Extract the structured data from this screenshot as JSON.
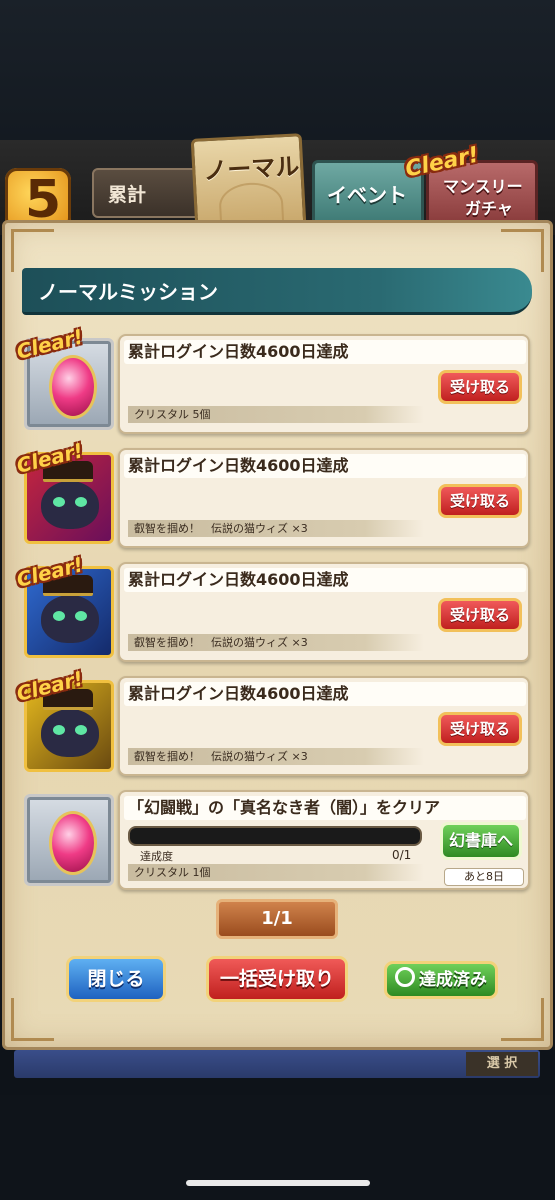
{
  "hud": {
    "number": "5",
    "total_label": "累計"
  },
  "tabs": {
    "normal": "ノーマル",
    "event": "イベント",
    "monthly_line1": "マンスリー",
    "monthly_line2": "ガチャ",
    "monthly_badge": "Clear!"
  },
  "header": {
    "title": "ノーマルミッション"
  },
  "missions": [
    {
      "clear": "Clear!",
      "title": "累計ログイン日数4600日達成",
      "reward": "クリスタル 5個",
      "button": "受け取る",
      "icon": "crystal-icon"
    },
    {
      "clear": "Clear!",
      "title": "累計ログイン日数4600日達成",
      "reward": "叡智を掴め！　伝説の猫ウィズ ×3",
      "button": "受け取る",
      "icon": "wiz-cat-red-icon"
    },
    {
      "clear": "Clear!",
      "title": "累計ログイン日数4600日達成",
      "reward": "叡智を掴め！　伝説の猫ウィズ ×3",
      "button": "受け取る",
      "icon": "wiz-cat-blue-icon"
    },
    {
      "clear": "Clear!",
      "title": "累計ログイン日数4600日達成",
      "reward": "叡智を掴め！　伝説の猫ウィズ ×3",
      "button": "受け取る",
      "icon": "wiz-cat-yellow-icon"
    },
    {
      "title": "「幻闘戦」の「真名なき者（闇）」をクリア",
      "progress_label": "達成度",
      "progress_value": "0/1",
      "progress_fraction": 0,
      "reward": "クリスタル 1個",
      "button": "幻書庫へ",
      "remaining": "あと8日",
      "icon": "crystal-icon"
    }
  ],
  "pager": {
    "label": "1/1"
  },
  "footer": {
    "close": "閉じる",
    "bulk_receive": "一括受け取り",
    "completed": "達成済み",
    "select": "選 択"
  }
}
